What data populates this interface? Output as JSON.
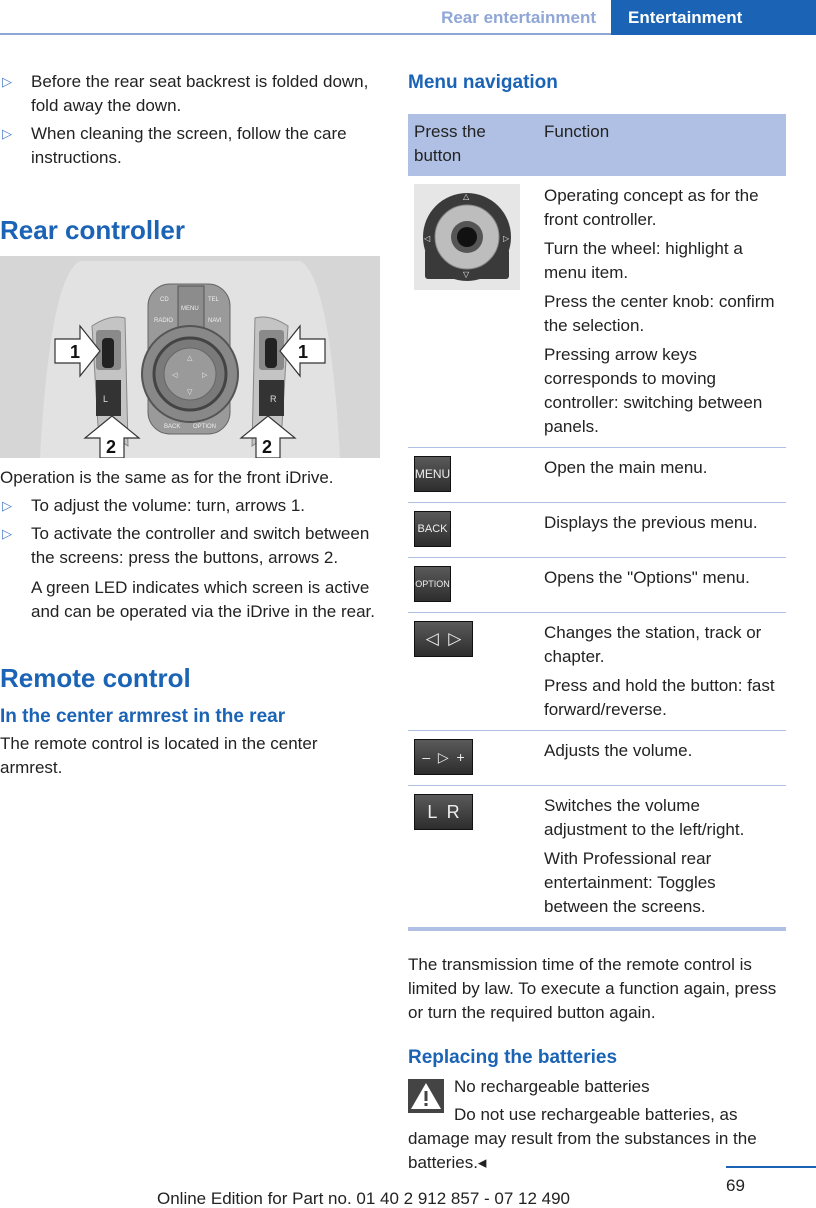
{
  "header": {
    "section": "Rear entertainment",
    "chapter": "Entertainment"
  },
  "left": {
    "intro_bullets": [
      "Before the rear seat backrest is folded down, fold away the down.",
      "When cleaning the screen, follow the care instructions."
    ],
    "rear_controller": {
      "title": "Rear controller",
      "figure": {
        "buttons": [
          "CD",
          "MENU",
          "TEL",
          "RADIO",
          "NAVI",
          "BACK",
          "OPTION"
        ],
        "callouts": [
          "1",
          "1",
          "2",
          "2"
        ],
        "side_labels": [
          "L",
          "R"
        ]
      },
      "intro": "Operation is the same as for the front iDrive.",
      "bullets": [
        "To adjust the volume: turn, arrows 1.",
        "To activate the controller and switch between the screens: press the buttons, arrows 2."
      ],
      "note": "A green LED indicates which screen is active and can be operated via the iDrive in the rear."
    },
    "remote_control": {
      "title": "Remote control",
      "subtitle": "In the center armrest in the rear",
      "text": "The remote control is located in the center armrest."
    }
  },
  "right": {
    "menu_nav": {
      "title": "Menu navigation",
      "headers": [
        "Press the button",
        "Function"
      ],
      "rows": [
        {
          "button_icon": "controller-knob-icon",
          "button_label": "",
          "functions": [
            "Operating concept as for the front controller.",
            "Turn the wheel: highlight a menu item.",
            "Press the center knob: confirm the selection.",
            "Pressing arrow keys corresponds to moving controller: switching between panels."
          ]
        },
        {
          "button_icon": "menu-key-icon",
          "button_label": "MENU",
          "functions": [
            "Open the main menu."
          ]
        },
        {
          "button_icon": "back-key-icon",
          "button_label": "BACK",
          "functions": [
            "Displays the previous menu."
          ]
        },
        {
          "button_icon": "option-key-icon",
          "button_label": "OPTION",
          "functions": [
            "Opens the \"Options\" menu."
          ]
        },
        {
          "button_icon": "skip-keys-icon",
          "button_label": "◁  ▷",
          "functions": [
            "Changes the station, track or chapter.",
            "Press and hold the button: fast forward/reverse."
          ]
        },
        {
          "button_icon": "volume-key-icon",
          "button_label": "–  ▷  +",
          "functions": [
            "Adjusts the volume."
          ]
        },
        {
          "button_icon": "headphone-lr-key-icon",
          "button_label": "L  R",
          "functions": [
            "Switches the volume adjustment to the left/right.",
            "With Professional rear entertainment: Toggles between the screens."
          ]
        }
      ]
    },
    "transmission_text": "The transmission time of the remote control is limited by law. To execute a function again, press or turn the required button again.",
    "batteries": {
      "title": "Replacing the batteries",
      "warning_title": "No rechargeable batteries",
      "warning_text": "Do not use rechargeable batteries, as damage may result from the substances in the batteries.◂"
    }
  },
  "footer": {
    "page_number": "69",
    "edition": "Online Edition for Part no. 01 40 2 912 857 - 07 12 490"
  },
  "colors": {
    "accent": "#1a63b5",
    "table_header": "#b0c0e4",
    "header_section": "#8fa6d6"
  }
}
